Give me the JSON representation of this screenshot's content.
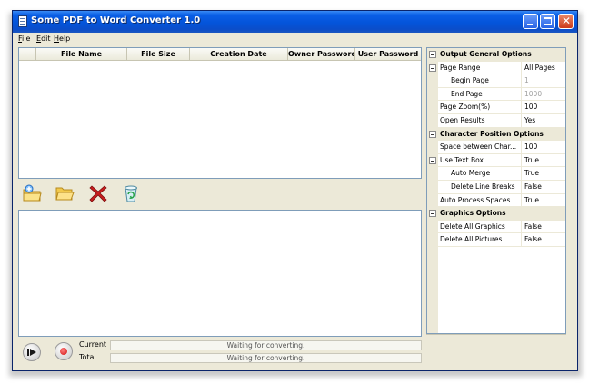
{
  "window": {
    "title": "Some PDF to Word Converter 1.0"
  },
  "menu": {
    "file": "File",
    "edit": "Edit",
    "help": "Help"
  },
  "file_list": {
    "columns": [
      "",
      "File Name",
      "File Size",
      "Creation Date",
      "Owner Password",
      "User Password"
    ]
  },
  "toolbar": {
    "icons": [
      "add-file-icon",
      "open-folder-icon",
      "delete-icon",
      "clear-list-icon"
    ]
  },
  "progress": {
    "current_label": "Current",
    "total_label": "Total",
    "current_status": "Waiting for converting.",
    "total_status": "Waiting for converting."
  },
  "properties": {
    "rows": [
      {
        "type": "category",
        "name": "Output General Options"
      },
      {
        "type": "prop",
        "name": "Page Range",
        "value": "All Pages",
        "expander": true
      },
      {
        "type": "prop",
        "name": "Begin Page",
        "value": "1",
        "indent": true,
        "dim": true
      },
      {
        "type": "prop",
        "name": "End Page",
        "value": "1000",
        "indent": true,
        "dim": true
      },
      {
        "type": "prop",
        "name": "Page Zoom(%)",
        "value": "100"
      },
      {
        "type": "prop",
        "name": "Open Results",
        "value": "Yes"
      },
      {
        "type": "category",
        "name": "Character Position Options"
      },
      {
        "type": "prop",
        "name": "Space between Char...",
        "value": "100"
      },
      {
        "type": "prop",
        "name": "Use Text Box",
        "value": "True",
        "expander": true
      },
      {
        "type": "prop",
        "name": "Auto Merge",
        "value": "True",
        "indent": true
      },
      {
        "type": "prop",
        "name": "Delete Line Breaks",
        "value": "False",
        "indent": true
      },
      {
        "type": "prop",
        "name": "Auto Process Spaces",
        "value": "True"
      },
      {
        "type": "category",
        "name": "Graphics Options"
      },
      {
        "type": "prop",
        "name": "Delete All Graphics",
        "value": "False"
      },
      {
        "type": "prop",
        "name": "Delete All Pictures",
        "value": "False"
      }
    ]
  }
}
